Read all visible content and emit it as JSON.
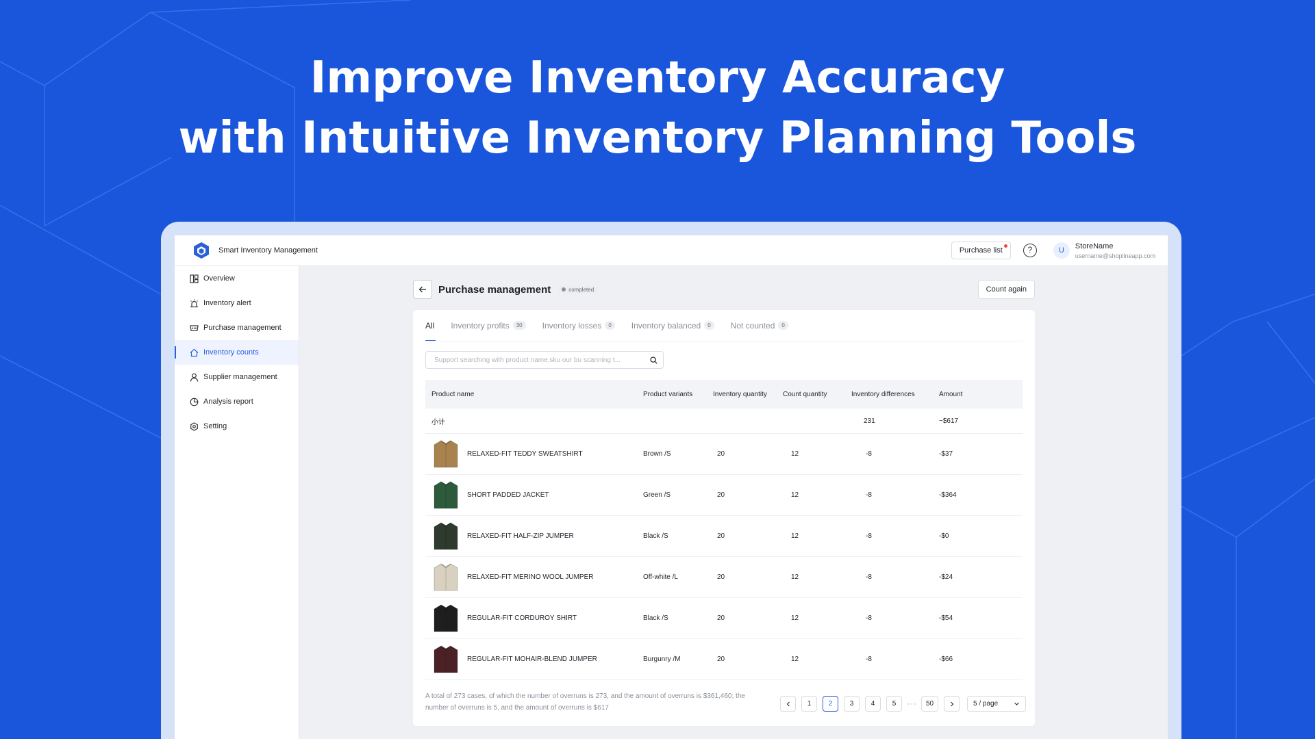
{
  "hero": {
    "line1": "Improve Inventory Accuracy",
    "line2": "with Intuitive Inventory Planning Tools"
  },
  "colors": {
    "background": "#1a56db",
    "accent": "#2b5fd9",
    "badge_dot": "#f5483b"
  },
  "app": {
    "title": "Smart Inventory Management",
    "logo_icon": "hexagon-cube-icon",
    "purchase_list_label": "Purchase list",
    "help_icon": "question-circle-icon",
    "avatar_letter": "U",
    "store_name": "StoreName",
    "user_email": "username@shoplineapp.com"
  },
  "sidebar": {
    "items": [
      {
        "label": "Overview",
        "icon": "dashboard-icon"
      },
      {
        "label": "Inventory alert",
        "icon": "alarm-icon"
      },
      {
        "label": "Purchase management",
        "icon": "basket-icon"
      },
      {
        "label": "Inventory counts",
        "icon": "home-icon",
        "active": true
      },
      {
        "label": "Supplier management",
        "icon": "user-icon"
      },
      {
        "label": "Analysis report",
        "icon": "pie-chart-icon"
      },
      {
        "label": "Setting",
        "icon": "gear-icon"
      }
    ]
  },
  "page": {
    "title": "Purchase management",
    "status": "completed",
    "count_again_label": "Count again"
  },
  "tabs": [
    {
      "label": "All",
      "count": ""
    },
    {
      "label": "Inventory profits",
      "count": "30"
    },
    {
      "label": "Inventory losses",
      "count": "0"
    },
    {
      "label": "Inventory balanced",
      "count": "0"
    },
    {
      "label": "Not counted",
      "count": "0"
    }
  ],
  "search": {
    "placeholder": "Support searching with product name,sku our bu scanning t..."
  },
  "table": {
    "headers": [
      "Product name",
      "Product variants",
      "Inventory quantity",
      "Count quantity",
      "Inventory differences",
      "Amount"
    ],
    "subtotal": {
      "label": "小计",
      "differences": "231",
      "amount": "−$617"
    },
    "rows": [
      {
        "name": "RELAXED-FIT TEDDY SWEATSHIRT",
        "variant": "Brown /S",
        "inventory": "20",
        "count": "12",
        "diff": "-8",
        "amount": "-$37",
        "color": "#a9834e"
      },
      {
        "name": "SHORT PADDED JACKET",
        "variant": "Green /S",
        "inventory": "20",
        "count": "12",
        "diff": "-8",
        "amount": "-$364",
        "color": "#2c5a3a"
      },
      {
        "name": "RELAXED-FIT HALF-ZIP JUMPER",
        "variant": "Black /S",
        "inventory": "20",
        "count": "12",
        "diff": "-8",
        "amount": "-$0",
        "color": "#2d3a2d"
      },
      {
        "name": "RELAXED-FIT MERINO WOOL JUMPER",
        "variant": "Off-white /L",
        "inventory": "20",
        "count": "12",
        "diff": "-8",
        "amount": "-$24",
        "color": "#d9d1bf"
      },
      {
        "name": "REGULAR-FIT CORDUROY SHIRT",
        "variant": "Black /S",
        "inventory": "20",
        "count": "12",
        "diff": "-8",
        "amount": "-$54",
        "color": "#1e1e1e"
      },
      {
        "name": "REGULAR-FIT MOHAIR-BLEND JUMPER",
        "variant": "Burgunry /M",
        "inventory": "20",
        "count": "12",
        "diff": "-8",
        "amount": "-$66",
        "color": "#4a2226"
      }
    ]
  },
  "footer": {
    "note": "A total of 273 cases, of which the number of overruns is 273, and the amount of overruns is $361,460; the number of overruns is 5, and the amount of overruns is $617",
    "pages": [
      "1",
      "2",
      "3",
      "4",
      "5"
    ],
    "current_page": "2",
    "ellipsis": "···",
    "last_page": "50",
    "page_size": "5 / page"
  }
}
